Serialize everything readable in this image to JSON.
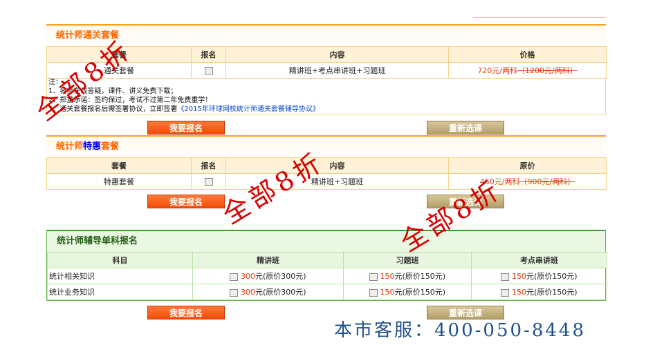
{
  "sec1": {
    "title": "统计师通关套餐",
    "headers": [
      "套餐",
      "报名",
      "内容",
      "价格"
    ],
    "row": {
      "name": "通关套餐",
      "content": "精讲班+考点串讲班+习题班",
      "price": "720元/两科",
      "orig": "（1200元/两科）"
    },
    "notes": {
      "label": "注：",
      "n1": "1、名师在线答疑，课件、讲义免费下载；",
      "n2": "2、郑重承诺：签约保过，考试不过第二年免费重学！",
      "n3_pre": "3、通关套餐报名后需签署协议，立即签署",
      "n3_link": "《2015年环球网校统计师通关套餐辅导协议》"
    },
    "enroll": "我要报名",
    "reset": "重新选课"
  },
  "sec2": {
    "title_a": "统计师",
    "title_b": "特惠",
    "title_c": "套餐",
    "headers": [
      "套餐",
      "报名",
      "内容",
      "原价"
    ],
    "row": {
      "name": "特惠套餐",
      "content": "精讲班+习题班",
      "price": "450元/两科",
      "orig": "（900元/两科）"
    },
    "enroll": "我要报名",
    "reset": "重新选课"
  },
  "sec3": {
    "title": "统计师辅导单科报名",
    "headers": [
      "科目",
      "精讲班",
      "习题班",
      "考点串讲班"
    ],
    "rows": [
      {
        "subject": "统计相关知识",
        "p1": "300",
        "p1s": "元(原价300元)",
        "p2": "150",
        "p2s": "元(原价150元)",
        "p3": "150",
        "p3s": "元(原价150元)"
      },
      {
        "subject": "统计业务知识",
        "p1": "300",
        "p1s": "元(原价300元)",
        "p2": "150",
        "p2s": "元(原价150元)",
        "p3": "150",
        "p3s": "元(原价150元)"
      }
    ],
    "enroll": "我要报名",
    "reset": "重新选课"
  },
  "watermark": "全部8折",
  "hotline": "本市客服：400-050-8448"
}
